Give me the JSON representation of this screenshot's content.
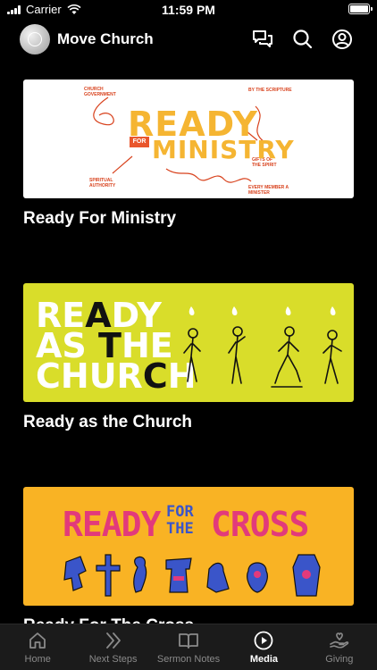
{
  "status_bar": {
    "carrier": "Carrier",
    "time": "11:59 PM"
  },
  "header": {
    "title": "Move Church",
    "icons": [
      "chat-icon",
      "search-icon",
      "profile-icon"
    ]
  },
  "media": [
    {
      "title": "Ready For Ministry",
      "art": {
        "line1": "READY",
        "tag": "FOR",
        "line2": "MINISTRY",
        "notes": [
          "CHURCH GOVERNMENT",
          "BY THE SCRIPTURE",
          "GIFTS OF THE SPIRIT",
          "SPIRITUAL AUTHORITY",
          "EVERY MEMBER A MINISTER"
        ]
      }
    },
    {
      "title": "Ready as the Church",
      "art": {
        "line1": [
          "RE",
          "A",
          "DY"
        ],
        "line2": [
          "AS",
          " T",
          "HE"
        ],
        "line3": [
          "CHUR",
          "C",
          "H"
        ]
      }
    },
    {
      "title": "Ready For The Cross",
      "art": {
        "left": "READY",
        "middle": "FOR THE",
        "right": "CROSS"
      }
    }
  ],
  "tabs": [
    {
      "label": "Home",
      "icon": "home-icon",
      "active": false
    },
    {
      "label": "Next Steps",
      "icon": "chevrons-icon",
      "active": false
    },
    {
      "label": "Sermon Notes",
      "icon": "book-icon",
      "active": false
    },
    {
      "label": "Media",
      "icon": "play-circle-icon",
      "active": true
    },
    {
      "label": "Giving",
      "icon": "giving-hand-icon",
      "active": false
    }
  ],
  "colors": {
    "background": "#000000",
    "tab_bar": "#1b1b1b",
    "tab_inactive": "#8a8a8a",
    "tab_active": "#ffffff",
    "ready_ministry_accent": "#f5b532",
    "ready_church_bg": "#d9dd2a",
    "ready_cross_bg": "#f9b324",
    "ready_cross_pink": "#e23a7b",
    "ready_cross_blue": "#3a55c9"
  }
}
